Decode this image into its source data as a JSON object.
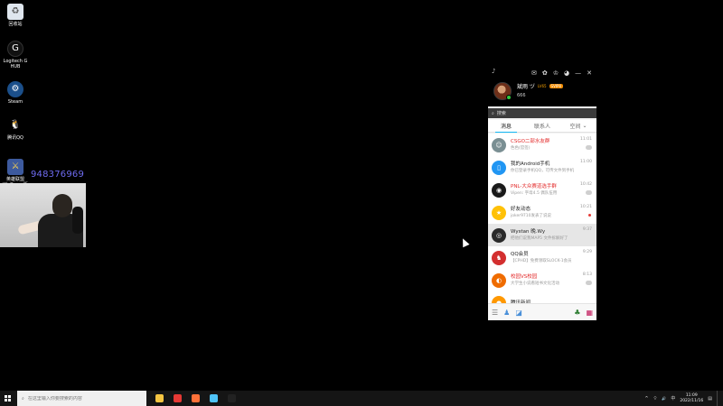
{
  "desktop": {
    "icons": [
      {
        "label": "回收站",
        "icon": "recycle-bin-icon"
      },
      {
        "label": "Logitech G HUB",
        "icon": "logitech-icon"
      },
      {
        "label": "Steam",
        "icon": "steam-icon"
      },
      {
        "label": "腾讯QQ",
        "icon": "qq-icon"
      },
      {
        "label": "英雄联盟WeGame版",
        "icon": "wegame-icon"
      }
    ],
    "stream_number": "948376969"
  },
  "qq": {
    "topbar": {
      "icons": [
        "bell-icon",
        "mail-icon",
        "game-icon",
        "shirt-icon",
        "qq-space-icon",
        "minimize-icon",
        "close-icon"
      ],
      "min": "—",
      "close": "✕"
    },
    "profile": {
      "nickname": "斌雨 ヅ",
      "level": "LV65",
      "vip": "SVIP8",
      "signature": "666"
    },
    "search_placeholder": "搜索",
    "tabs": [
      "消息",
      "联系人",
      "空间"
    ],
    "space_arrow": "⌄",
    "conversations": [
      {
        "name": "CSGO二部水友群",
        "preview": "色色(官签)",
        "time": "11:01",
        "red": true,
        "color": "#7a8f93",
        "glyph": "☺",
        "marker": "badge"
      },
      {
        "name": "我的Android手机",
        "preview": "你已登录手机QQ，可传文件到手机",
        "time": "11:00",
        "red": false,
        "color": "#2196f3",
        "glyph": "▯",
        "marker": "none"
      },
      {
        "name": "PNL-大众赛道选手群",
        "preview": "Vipen: 字母4.5 偶队伍用",
        "time": "10:42",
        "red": true,
        "color": "#1a1a1a",
        "glyph": "◉",
        "marker": "badge"
      },
      {
        "name": "好友动态",
        "preview": "joker9710发表了说说",
        "time": "10:21",
        "red": false,
        "color": "#ffc107",
        "glyph": "★",
        "marker": "dot"
      },
      {
        "name": "Wystan 晚.Wy",
        "preview": "把他们说我MAP5 文件拆解好了",
        "time": "9:37",
        "red": false,
        "color": "#2a2a2a",
        "glyph": "◎",
        "marker": "none"
      },
      {
        "name": "QQ会员",
        "preview": "【CPHD】免费领取SLOCK-1会员",
        "time": "9:29",
        "red": false,
        "color": "#d32f2f",
        "glyph": "♞",
        "marker": "none"
      },
      {
        "name": "校园VS校园",
        "preview": "大学生小说看短书文化活动",
        "time": "8:13",
        "red": true,
        "color": "#ef6c00",
        "glyph": "◐",
        "marker": "badge"
      },
      {
        "name": "腾讯新闻",
        "preview": "",
        "time": "",
        "red": false,
        "color": "#ff9800",
        "glyph": "●",
        "marker": "none"
      }
    ],
    "bottom": {
      "menu": "☰",
      "contacts": "♟",
      "app": "◪",
      "gift": "♣",
      "grid": "▦"
    }
  },
  "taskbar": {
    "search_placeholder": "在这里输入你要搜索的内容",
    "apps": [
      {
        "name": "file-explorer-icon",
        "color": "#f5c542"
      },
      {
        "name": "filmora-icon",
        "color": "#e53935"
      },
      {
        "name": "firefox-icon",
        "color": "#ff7139"
      },
      {
        "name": "media-player-icon",
        "color": "#4fc3f7"
      },
      {
        "name": "qq-taskbar-icon",
        "color": "#222222"
      }
    ],
    "tray": {
      "chevron": "^",
      "wifi": "⌔",
      "volume": "🔊",
      "ime": "中",
      "notification": "▤"
    },
    "clock": {
      "time": "11:09",
      "date": "2022/11/16"
    }
  }
}
